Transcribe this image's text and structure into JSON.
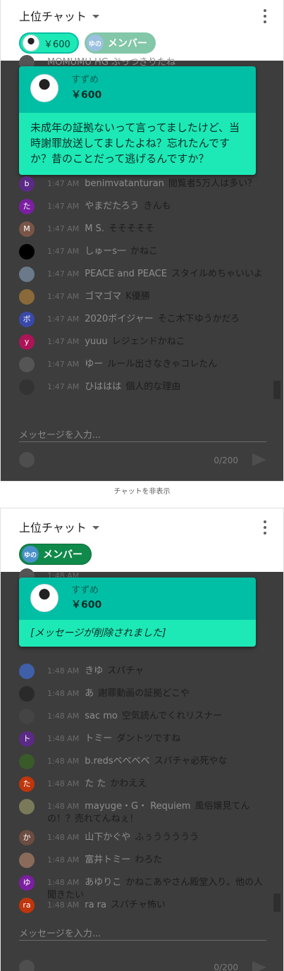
{
  "panel1": {
    "header": {
      "title": "上位チャット"
    },
    "tickers": [
      {
        "label": "￥600"
      },
      {
        "label": "メンバー",
        "avatar": "ゆの"
      }
    ],
    "top_clip": "MOMUMU HG ぷっつきりたね",
    "superchat": {
      "author": "すずめ",
      "amount": "￥600",
      "message": "未成年の証拠ないって言ってましたけど、当時謝罪放送してましたよね？忘れたんですか？昔のことだって逃げるんですか？"
    },
    "messages": [
      {
        "time": "1:47 AM",
        "author": "benimvatanturan",
        "text": "閲覧者5万人は多い？",
        "initial": "b",
        "color": "#5b2a86"
      },
      {
        "time": "1:47 AM",
        "author": "やまだたろう",
        "text": "きんも",
        "initial": "た",
        "color": "#7b1fa2"
      },
      {
        "time": "1:47 AM",
        "author": "M S.",
        "text": "そそそそそ",
        "initial": "M",
        "color": "#795548"
      },
      {
        "time": "1:47 AM",
        "author": "しゅーs一",
        "text": "かねこ",
        "initial": "",
        "color": "#000000"
      },
      {
        "time": "1:47 AM",
        "author": "PEACE and PEACE",
        "text": "スタイルめちゃいいよ",
        "initial": "",
        "color": "#6a7a8a"
      },
      {
        "time": "1:47 AM",
        "author": "ゴマゴマ",
        "text": "K優勝",
        "initial": "",
        "color": "#8a6a3a"
      },
      {
        "time": "1:47 AM",
        "author": "2020ボイジャー",
        "text": "そこ木下ゆうかだろ",
        "initial": "ボ",
        "color": "#3949ab"
      },
      {
        "time": "1:47 AM",
        "author": "yuuu",
        "text": "レジェンドかねこ",
        "initial": "y",
        "color": "#ad1457"
      },
      {
        "time": "1:47 AM",
        "author": "ゆー",
        "text": "ルール出さなきゃコレたん",
        "initial": "",
        "color": "#555555"
      },
      {
        "time": "1:47 AM",
        "author": "ひははは",
        "text": "個人的な理由",
        "initial": "",
        "color": "#333333"
      }
    ],
    "input": {
      "placeholder": "メッセージを入力...",
      "counter": "0/200"
    },
    "hide_chat": "チャットを非表示"
  },
  "panel2": {
    "header": {
      "title": "上位チャット"
    },
    "tickers": [
      {
        "label": "メンバー",
        "avatar": "ゆの"
      }
    ],
    "top_clip": "1:48 AM",
    "superchat": {
      "author": "すずめ",
      "amount": "￥600",
      "message": "[メッセージが削除されました]"
    },
    "messages": [
      {
        "time": "1:48 AM",
        "author": "きゆ",
        "text": "スパチャ",
        "initial": "",
        "color": "#3f5fa8"
      },
      {
        "time": "1:48 AM",
        "author": "あ",
        "text": "謝罪動画の証拠どこや",
        "initial": "",
        "color": "#2a2a2a"
      },
      {
        "time": "1:48 AM",
        "author": "sac mo",
        "text": "空気読んでくれリスナー",
        "initial": "",
        "color": "#444444"
      },
      {
        "time": "1:48 AM",
        "author": "トミー",
        "text": "ダントツですね",
        "initial": "ト",
        "color": "#5b2a86"
      },
      {
        "time": "1:48 AM",
        "author": "b.redsべべべべ",
        "text": "スパチャ必死やな",
        "initial": "",
        "color": "#3a5a2a"
      },
      {
        "time": "1:48 AM",
        "author": "た た",
        "text": "かわええ",
        "initial": "た",
        "color": "#bf360c"
      },
      {
        "time": "1:48 AM",
        "author": "mayuge・G・ Requiem",
        "text": "風俗嬢見てんの！？売れてんねぇ！",
        "initial": "",
        "color": "#7a7a5a"
      },
      {
        "time": "1:48 AM",
        "author": "山下かぐや",
        "text": "ふぅううううう",
        "initial": "か",
        "color": "#6d4c41"
      },
      {
        "time": "1:48 AM",
        "author": "富井トミー",
        "text": "わろた",
        "initial": "",
        "color": "#8a6a5a"
      },
      {
        "time": "1:48 AM",
        "author": "あゆりこ",
        "text": "かねこあやさん殿堂入り。他の人聞きたい",
        "initial": "ゆ",
        "color": "#7b1fa2"
      },
      {
        "time": "1:48 AM",
        "author": "ra ra",
        "text": "スパチャ怖い",
        "initial": "ra",
        "color": "#bf360c"
      }
    ],
    "input": {
      "placeholder": "メッセージを入力...",
      "counter": "0/200"
    }
  }
}
